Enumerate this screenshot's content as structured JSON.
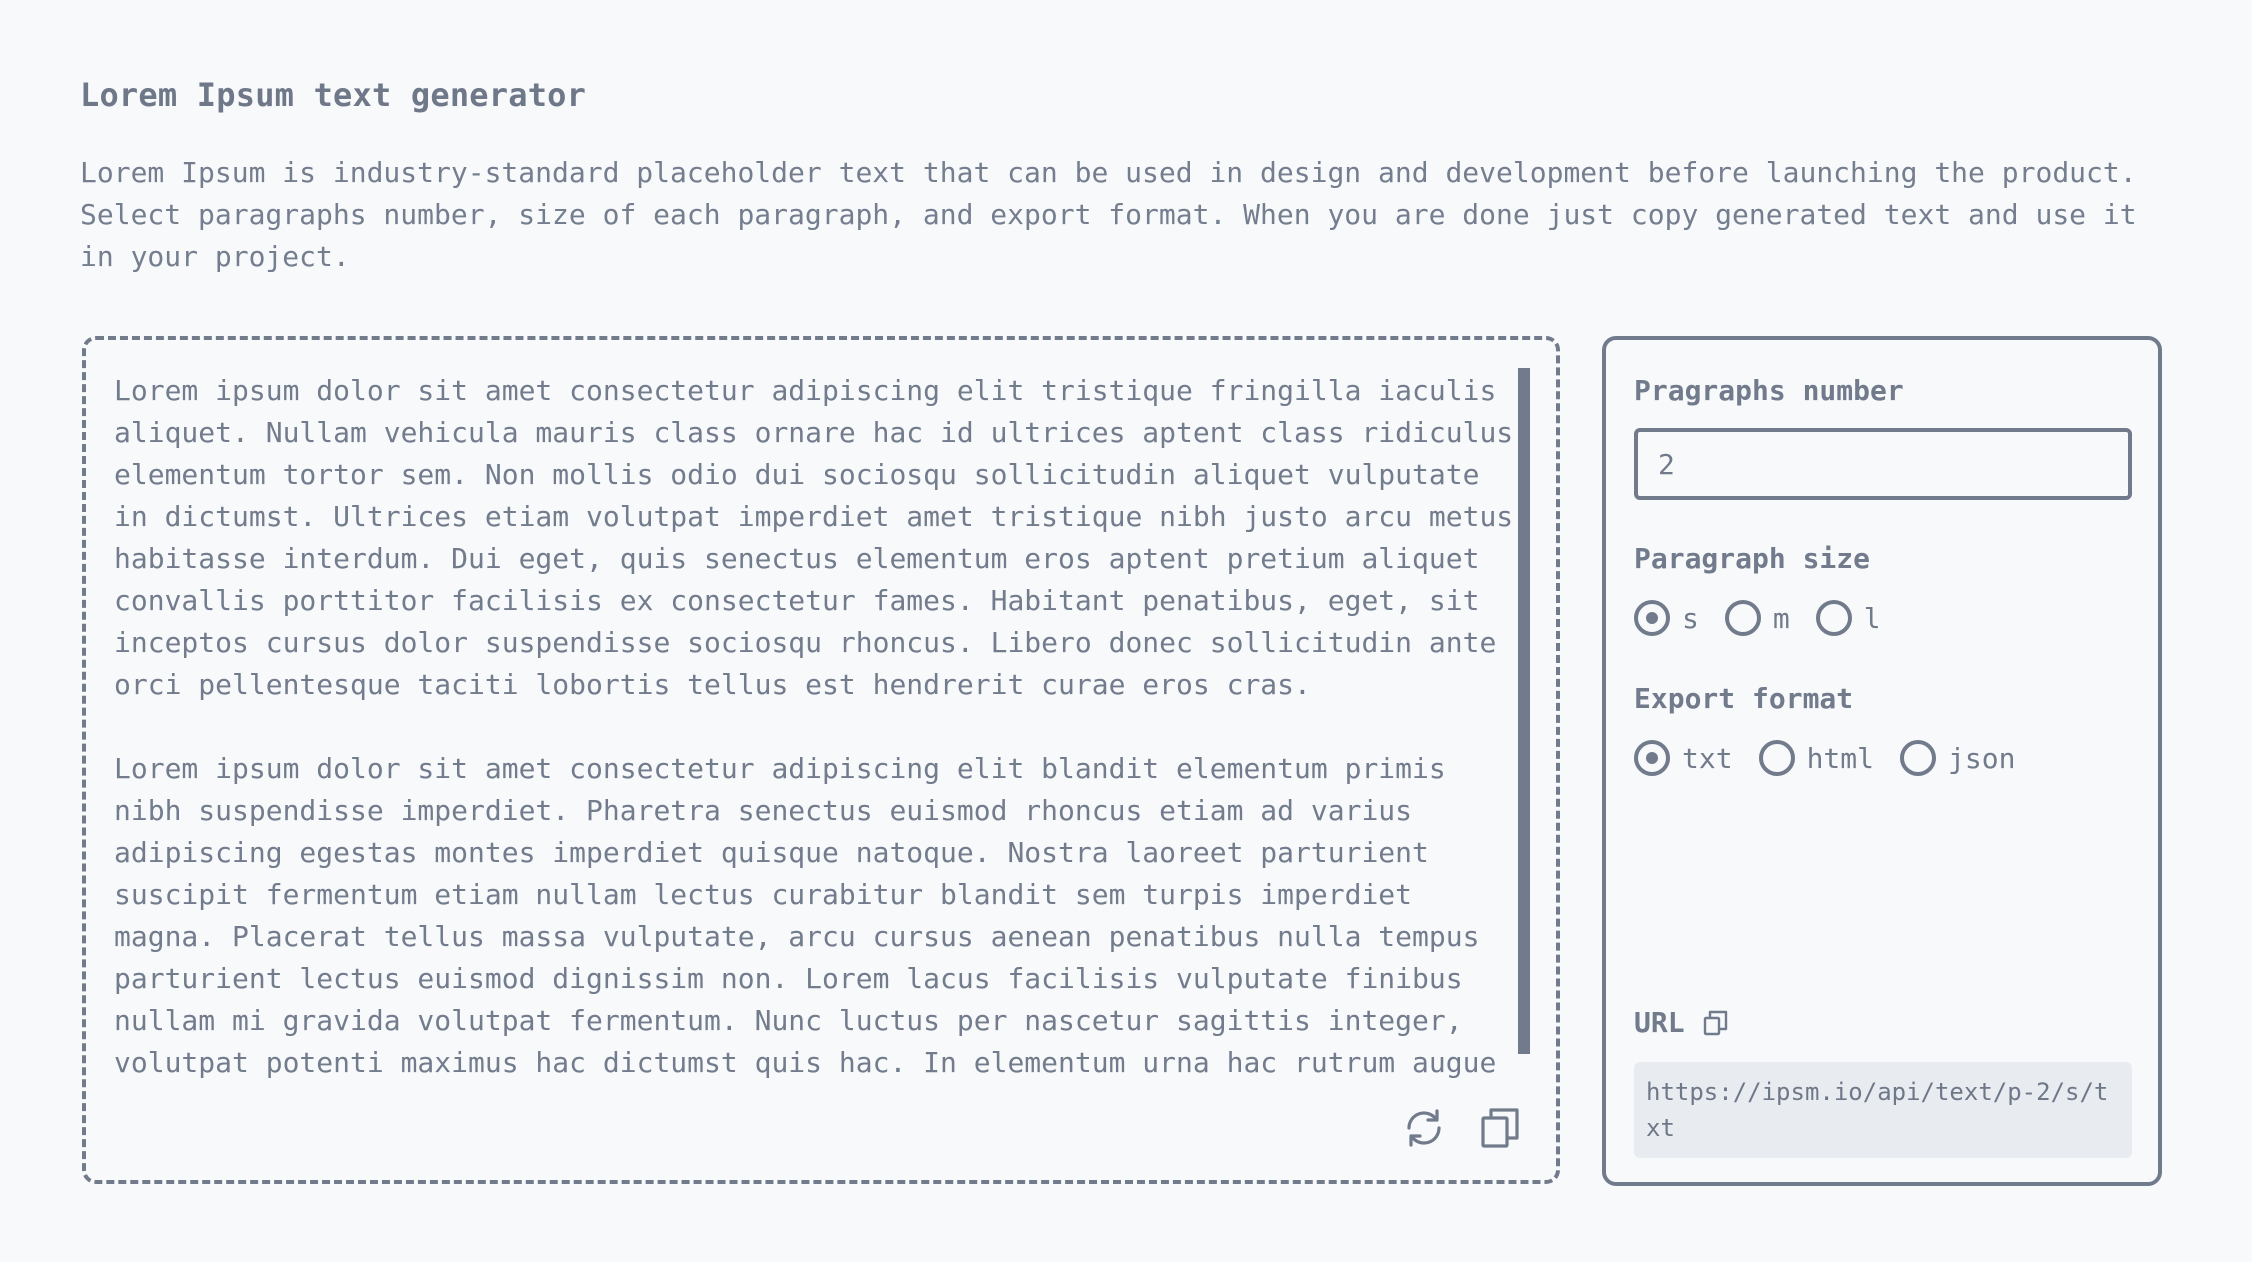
{
  "header": {
    "title": "Lorem Ipsum text generator",
    "description": "Lorem Ipsum is industry-standard placeholder text that can be used in design and development before launching the product. Select paragraphs number, size of each paragraph, and export format. When you are done just copy generated text and use it in your project."
  },
  "output": {
    "paragraphs": [
      "Lorem ipsum dolor sit amet consectetur adipiscing elit tristique fringilla iaculis aliquet. Nullam vehicula mauris class ornare hac id ultrices aptent class ridiculus elementum tortor sem. Non mollis odio dui sociosqu sollicitudin aliquet vulputate in dictumst. Ultrices etiam volutpat imperdiet amet tristique nibh justo arcu metus habitasse interdum. Dui eget, quis senectus elementum eros aptent pretium aliquet convallis porttitor facilisis ex consectetur fames. Habitant penatibus, eget, sit inceptos cursus dolor suspendisse sociosqu rhoncus. Libero donec sollicitudin ante orci pellentesque taciti lobortis tellus est hendrerit curae eros cras.",
      "Lorem ipsum dolor sit amet consectetur adipiscing elit blandit elementum primis nibh suspendisse imperdiet. Pharetra senectus euismod rhoncus etiam ad varius adipiscing egestas montes imperdiet quisque natoque. Nostra laoreet parturient suscipit fermentum etiam nullam lectus curabitur blandit sem turpis imperdiet magna. Placerat tellus massa vulputate, arcu cursus aenean penatibus nulla tempus parturient lectus euismod dignissim non. Lorem lacus facilisis vulputate finibus nullam mi gravida volutpat fermentum. Nunc luctus per nascetur sagittis integer, volutpat potenti maximus hac dictumst quis hac. In elementum urna hac rutrum augue"
    ],
    "actions": {
      "refresh_icon": "refresh-icon",
      "copy_icon": "copy-icon"
    }
  },
  "settings": {
    "paragraphs_label": "Pragraphs number",
    "paragraphs_value": "2",
    "size_label": "Paragraph size",
    "size_options": [
      {
        "label": "s",
        "checked": true
      },
      {
        "label": "m",
        "checked": false
      },
      {
        "label": "l",
        "checked": false
      }
    ],
    "format_label": "Export format",
    "format_options": [
      {
        "label": "txt",
        "checked": true
      },
      {
        "label": "html",
        "checked": false
      },
      {
        "label": "json",
        "checked": false
      }
    ],
    "url_label": "URL",
    "url_value": "https://ipsm.io/api/text/p-2/s/txt"
  },
  "colors": {
    "background": "#f8f9fb",
    "foreground": "#717b8c",
    "url_box": "#e8ebef"
  }
}
